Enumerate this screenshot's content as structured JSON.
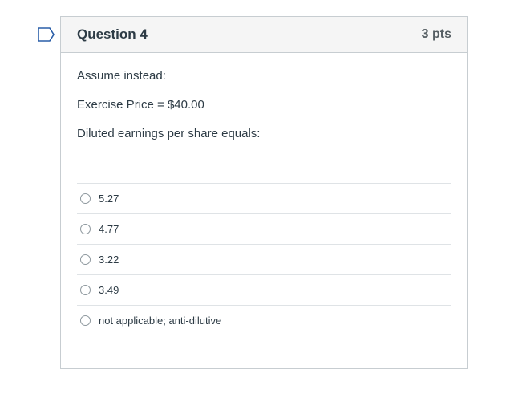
{
  "question": {
    "title": "Question 4",
    "points": "3 pts",
    "flag_icon": "bookmark-flag-icon",
    "text": [
      "Assume instead:",
      "Exercise Price = $40.00",
      "Diluted earnings per share equals:"
    ],
    "answers": [
      "5.27",
      "4.77",
      "3.22",
      "3.49",
      "not applicable; anti-dilutive"
    ],
    "colors": {
      "flag_border": "#2a5ea8",
      "header_bg": "#f5f5f5",
      "border": "#c7cdd1",
      "text": "#2d3b45"
    }
  }
}
